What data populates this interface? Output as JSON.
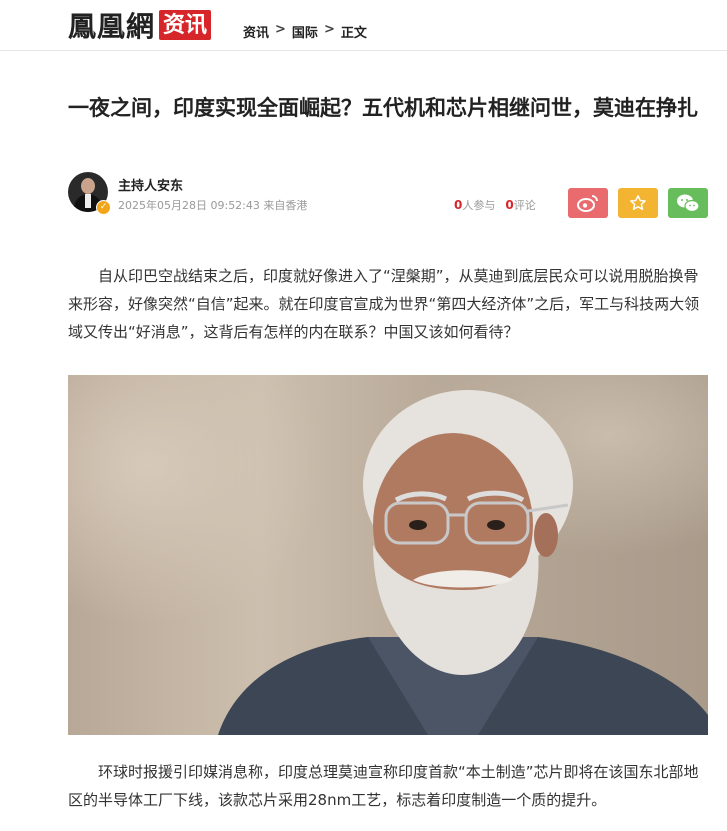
{
  "header": {
    "logo_main": "鳳凰網",
    "logo_sub": "资讯",
    "breadcrumb": [
      "资讯",
      "国际",
      "正文"
    ],
    "breadcrumb_sep": ">"
  },
  "article": {
    "title": "一夜之间，印度实现全面崛起？五代机和芯片相继问世，莫迪在挣扎",
    "author": "主持人安东",
    "datetime": "2025年05月28日 09:52:43",
    "source": "来自香港",
    "participants_count": "0",
    "participants_label": "人参与",
    "comments_count": "0",
    "comments_label": "评论",
    "paragraph1": "自从印巴空战结束之后，印度就好像进入了“涅槃期”，从莫迪到底层民众可以说用脱胎换骨来形容，好像突然“自信”起来。就在印度官宣成为世界“第四大经济体”之后，军工与科技两大领域又传出“好消息”，这背后有怎样的内在联系？中国又该如何看待？",
    "paragraph2": "环球时报援引印媒消息称，印度总理莫迪宣称印度首款“本土制造”芯片即将在该国东北部地区的半导体工厂下线，该款芯片采用28nm工艺，标志着印度制造一个质的提升。"
  },
  "share": {
    "weibo_icon": "weibo-icon",
    "favorite_icon": "star-icon",
    "wechat_icon": "wechat-icon"
  },
  "colors": {
    "brand_red": "#d7262a",
    "weibo": "#e96b6e",
    "favorite": "#f2b431",
    "wechat": "#67bd5b"
  }
}
